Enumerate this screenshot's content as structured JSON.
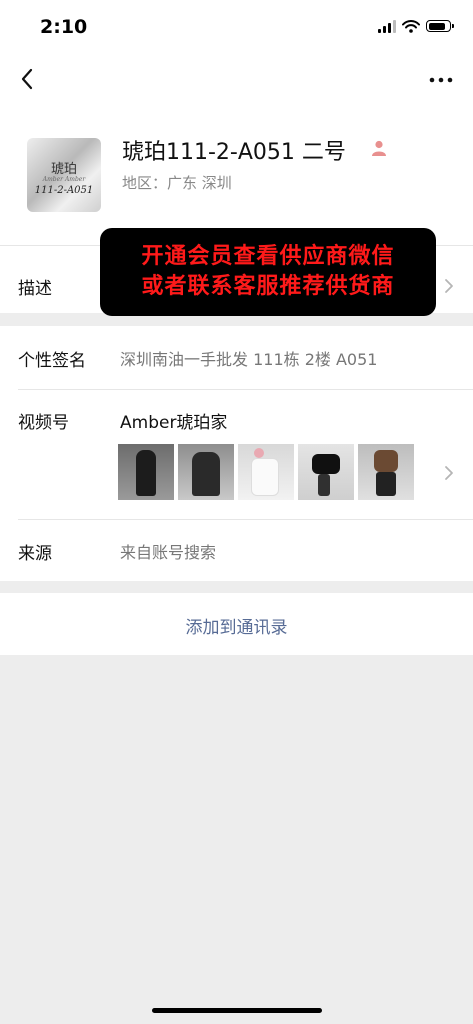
{
  "status": {
    "time": "2:10"
  },
  "profile": {
    "avatar_line1": "琥珀",
    "avatar_line2": "Amber Amber",
    "avatar_line3": "111-2-A051",
    "name": "琥珀111-2-A051 二号",
    "region": "地区：广东 深圳"
  },
  "overlay": {
    "line1": "开通会员查看供应商微信",
    "line2": "或者联系客服推荐供货商"
  },
  "rows": {
    "description_label": "描述",
    "signature_label": "个性签名",
    "signature_value": "深圳南油一手批发 111栋 2楼 A051",
    "channel_label": "视频号",
    "channel_name": "Amber琥珀家",
    "source_label": "来源",
    "source_value": "来自账号搜索"
  },
  "actions": {
    "add_contact": "添加到通讯录"
  },
  "colors": {
    "accent": "#576b95",
    "overlay_text": "#ff1a1a",
    "background": "#ededed"
  },
  "icons": [
    "back-icon",
    "more-icon",
    "person-icon",
    "chevron-right-icon"
  ]
}
